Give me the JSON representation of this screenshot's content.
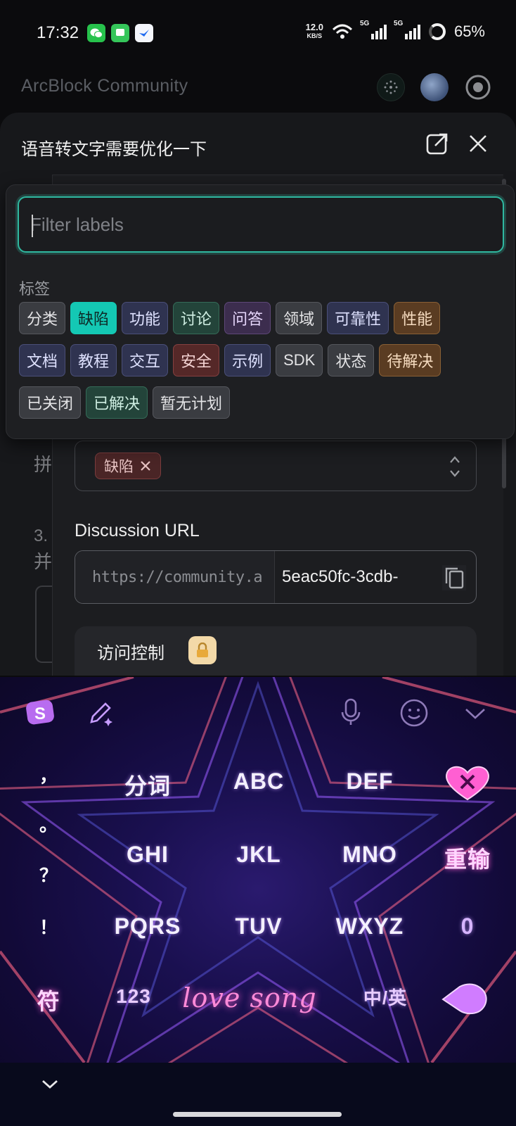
{
  "status_bar": {
    "time": "17:32",
    "net_speed": "12.0",
    "net_unit": "KB/S",
    "signal_1": "5G",
    "signal_2": "5G",
    "battery": "65%"
  },
  "app": {
    "title": "ArcBlock Community"
  },
  "sheet": {
    "title": "语音转文字需要优化一下",
    "left_glyph_1": "拼",
    "left_glyph_2": "3.",
    "left_glyph_3": "并"
  },
  "label_dropdown": {
    "filter_placeholder": "Filter labels",
    "heading": "标签",
    "rows": [
      [
        "分类",
        "缺陷",
        "功能",
        "讨论",
        "问答",
        "领域",
        "可靠性",
        "性能"
      ],
      [
        "文档",
        "教程",
        "交互",
        "安全",
        "示例",
        "SDK",
        "状态",
        "待解决"
      ],
      [
        "已关闭",
        "已解决",
        "暂无计划"
      ]
    ]
  },
  "form": {
    "selected_label": "缺陷",
    "discussion_url_label": "Discussion URL",
    "url_prefix": "https://community.a",
    "url_value": "5eac50fc-3cdb-",
    "access_control_label": "访问控制",
    "access_control_icon": "lock-icon"
  },
  "keyboard": {
    "punct": [
      "，",
      "。",
      "？",
      "！"
    ],
    "keys": {
      "r1": [
        "分词",
        "ABC",
        "DEF"
      ],
      "r2": [
        "GHI",
        "JKL",
        "MNO",
        "重输"
      ],
      "r3": [
        "PQRS",
        "TUV",
        "WXYZ",
        "0"
      ],
      "r4": [
        "符",
        "123",
        "love song",
        "中/英"
      ]
    }
  },
  "colors": {
    "accent": "#2fb8a0",
    "selected_tag": "#14c8b4"
  }
}
